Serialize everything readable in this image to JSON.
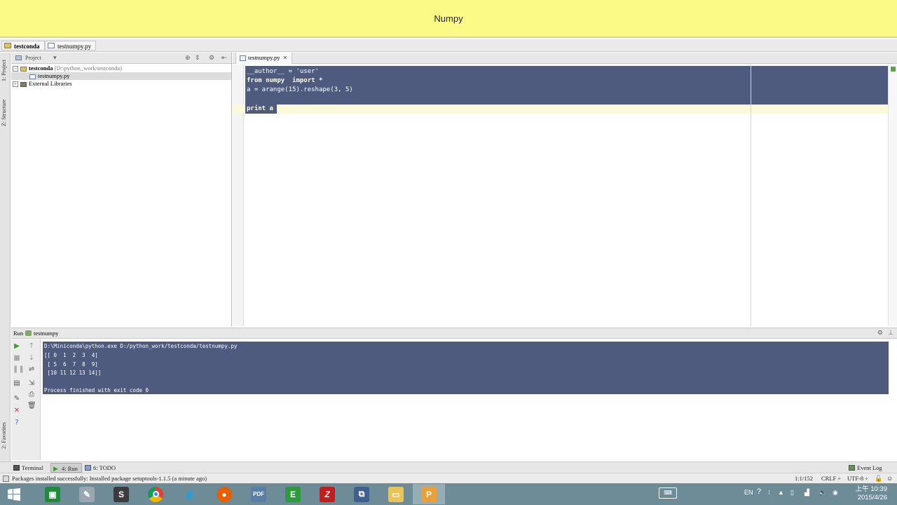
{
  "window": {
    "title": "Numpy"
  },
  "breadcrumb": [
    "testconda",
    "testnumpy.py"
  ],
  "left_strip": {
    "project_tab": "1: Project",
    "structure_tab": "Z: Structure",
    "favorites_tab": "2: Favorites"
  },
  "project_panel": {
    "header_label": "Project",
    "tree": [
      {
        "name": "testconda",
        "path": "(D:\\python_work\\testconda)"
      },
      {
        "name": "testnumpy.py"
      },
      {
        "name": "External Libraries"
      }
    ]
  },
  "editor": {
    "tab_label": "testnumpy.py",
    "lines": [
      "__author__ = 'user'",
      "from numpy  import *",
      "a = arange(15).reshape(3, 5)",
      "",
      "print a"
    ]
  },
  "run_panel": {
    "header_label": "Run",
    "config_name": "testnumpy",
    "console_lines": [
      "D:\\Miniconda\\python.exe D:/python_work/testconda/testnumpy.py",
      "[[ 0  1  2  3  4]",
      " [ 5  6  7  8  9]",
      " [10 11 12 13 14]]",
      "",
      "Process finished with exit code 0"
    ]
  },
  "bottom_tabs": [
    {
      "label": "Terminal"
    },
    {
      "label": "4: Run",
      "active": true
    },
    {
      "label": "6: TODO"
    }
  ],
  "event_log_label": "Event Log",
  "status": {
    "message": "Packages installed successfully: Installed package setuptools-1.1.5 (a minute ago)",
    "position": "1:1/152",
    "line_sep": "CRLF ÷",
    "encoding": "UTF-8 ÷"
  },
  "taskbar": {
    "apps": [
      "Windows Explorer",
      "Paint",
      "Sublime Text",
      "Chrome",
      "Internet Explorer",
      "Firefox",
      "PDF",
      "Evernote",
      "FileZilla",
      "Remote Desktop",
      "File Explorer",
      "PyCharm"
    ],
    "language": "EN",
    "time": "上午 10:39",
    "date": "2015/4/26"
  }
}
